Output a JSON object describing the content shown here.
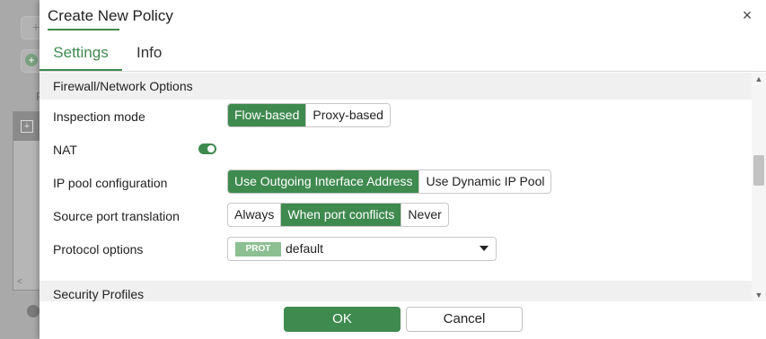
{
  "background": {
    "plus_glyph": "+",
    "dot_glyph": "+",
    "letter": "P",
    "panel_glyph": "+",
    "arrow_glyph": "<"
  },
  "dialog": {
    "title": "Create New Policy",
    "close_glyph": "×"
  },
  "tabs": [
    {
      "label": "Settings",
      "active": true
    },
    {
      "label": "Info",
      "active": false
    }
  ],
  "sections": {
    "firewall_title": "Firewall/Network Options",
    "security_title": "Security Profiles"
  },
  "inspection_mode": {
    "label": "Inspection mode",
    "options": [
      "Flow-based",
      "Proxy-based"
    ],
    "selected": "Flow-based"
  },
  "nat": {
    "label": "NAT",
    "enabled": true
  },
  "ip_pool": {
    "label": "IP pool configuration",
    "options": [
      "Use Outgoing Interface Address",
      "Use Dynamic IP Pool"
    ],
    "selected": "Use Outgoing Interface Address"
  },
  "source_port": {
    "label": "Source port translation",
    "options": [
      "Always",
      "When port conflicts",
      "Never"
    ],
    "selected": "When port conflicts"
  },
  "protocol_options": {
    "label": "Protocol options",
    "badge": "PROT",
    "value": "default"
  },
  "scroll": {
    "up_glyph": "▲",
    "down_glyph": "▼"
  },
  "footer": {
    "ok_label": "OK",
    "cancel_label": "Cancel"
  },
  "colors": {
    "accent": "#3f8a4f",
    "badge": "#8cbf92",
    "section_bg": "#f0f0f0"
  }
}
